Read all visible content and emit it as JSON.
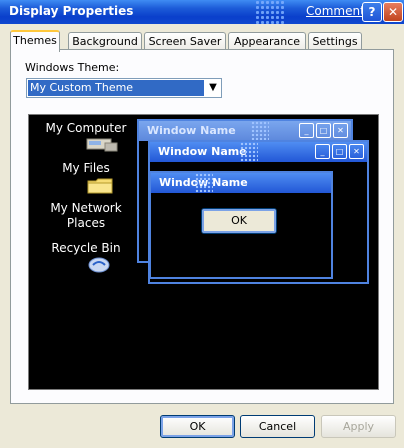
{
  "window": {
    "title": "Display Properties",
    "comments_link": "Comments?",
    "help_glyph": "?",
    "close_glyph": "✕"
  },
  "tabs": [
    {
      "label": "Themes",
      "active": true
    },
    {
      "label": "Background",
      "active": false
    },
    {
      "label": "Screen Saver",
      "active": false
    },
    {
      "label": "Appearance",
      "active": false
    },
    {
      "label": "Settings",
      "active": false
    }
  ],
  "theme": {
    "label": "Windows Theme:",
    "selected": "My Custom Theme"
  },
  "preview": {
    "desktop_icons": [
      {
        "label": "My Computer",
        "icon": "computer-icon"
      },
      {
        "label": "My Files",
        "icon": "folder-icon"
      },
      {
        "label": "My Network Places",
        "icon": "network-icon"
      },
      {
        "label": "Recycle Bin",
        "icon": "recycle-bin-icon"
      }
    ],
    "windows": [
      {
        "title": "Window Name",
        "state": "inactive"
      },
      {
        "title": "Window Name",
        "state": "active"
      },
      {
        "title": "Window Name",
        "state": "message-box"
      }
    ],
    "message_box_button": "OK",
    "caption_glyphs": {
      "minimize": "_",
      "maximize": "□",
      "close": "✕"
    }
  },
  "buttons": {
    "ok": "OK",
    "cancel": "Cancel",
    "apply": "Apply"
  },
  "colors": {
    "title_blue": "#0a3fcb",
    "selection": "#316ac5",
    "dialog_bg": "#ece9d8",
    "tab_highlight": "#ffc83c"
  }
}
